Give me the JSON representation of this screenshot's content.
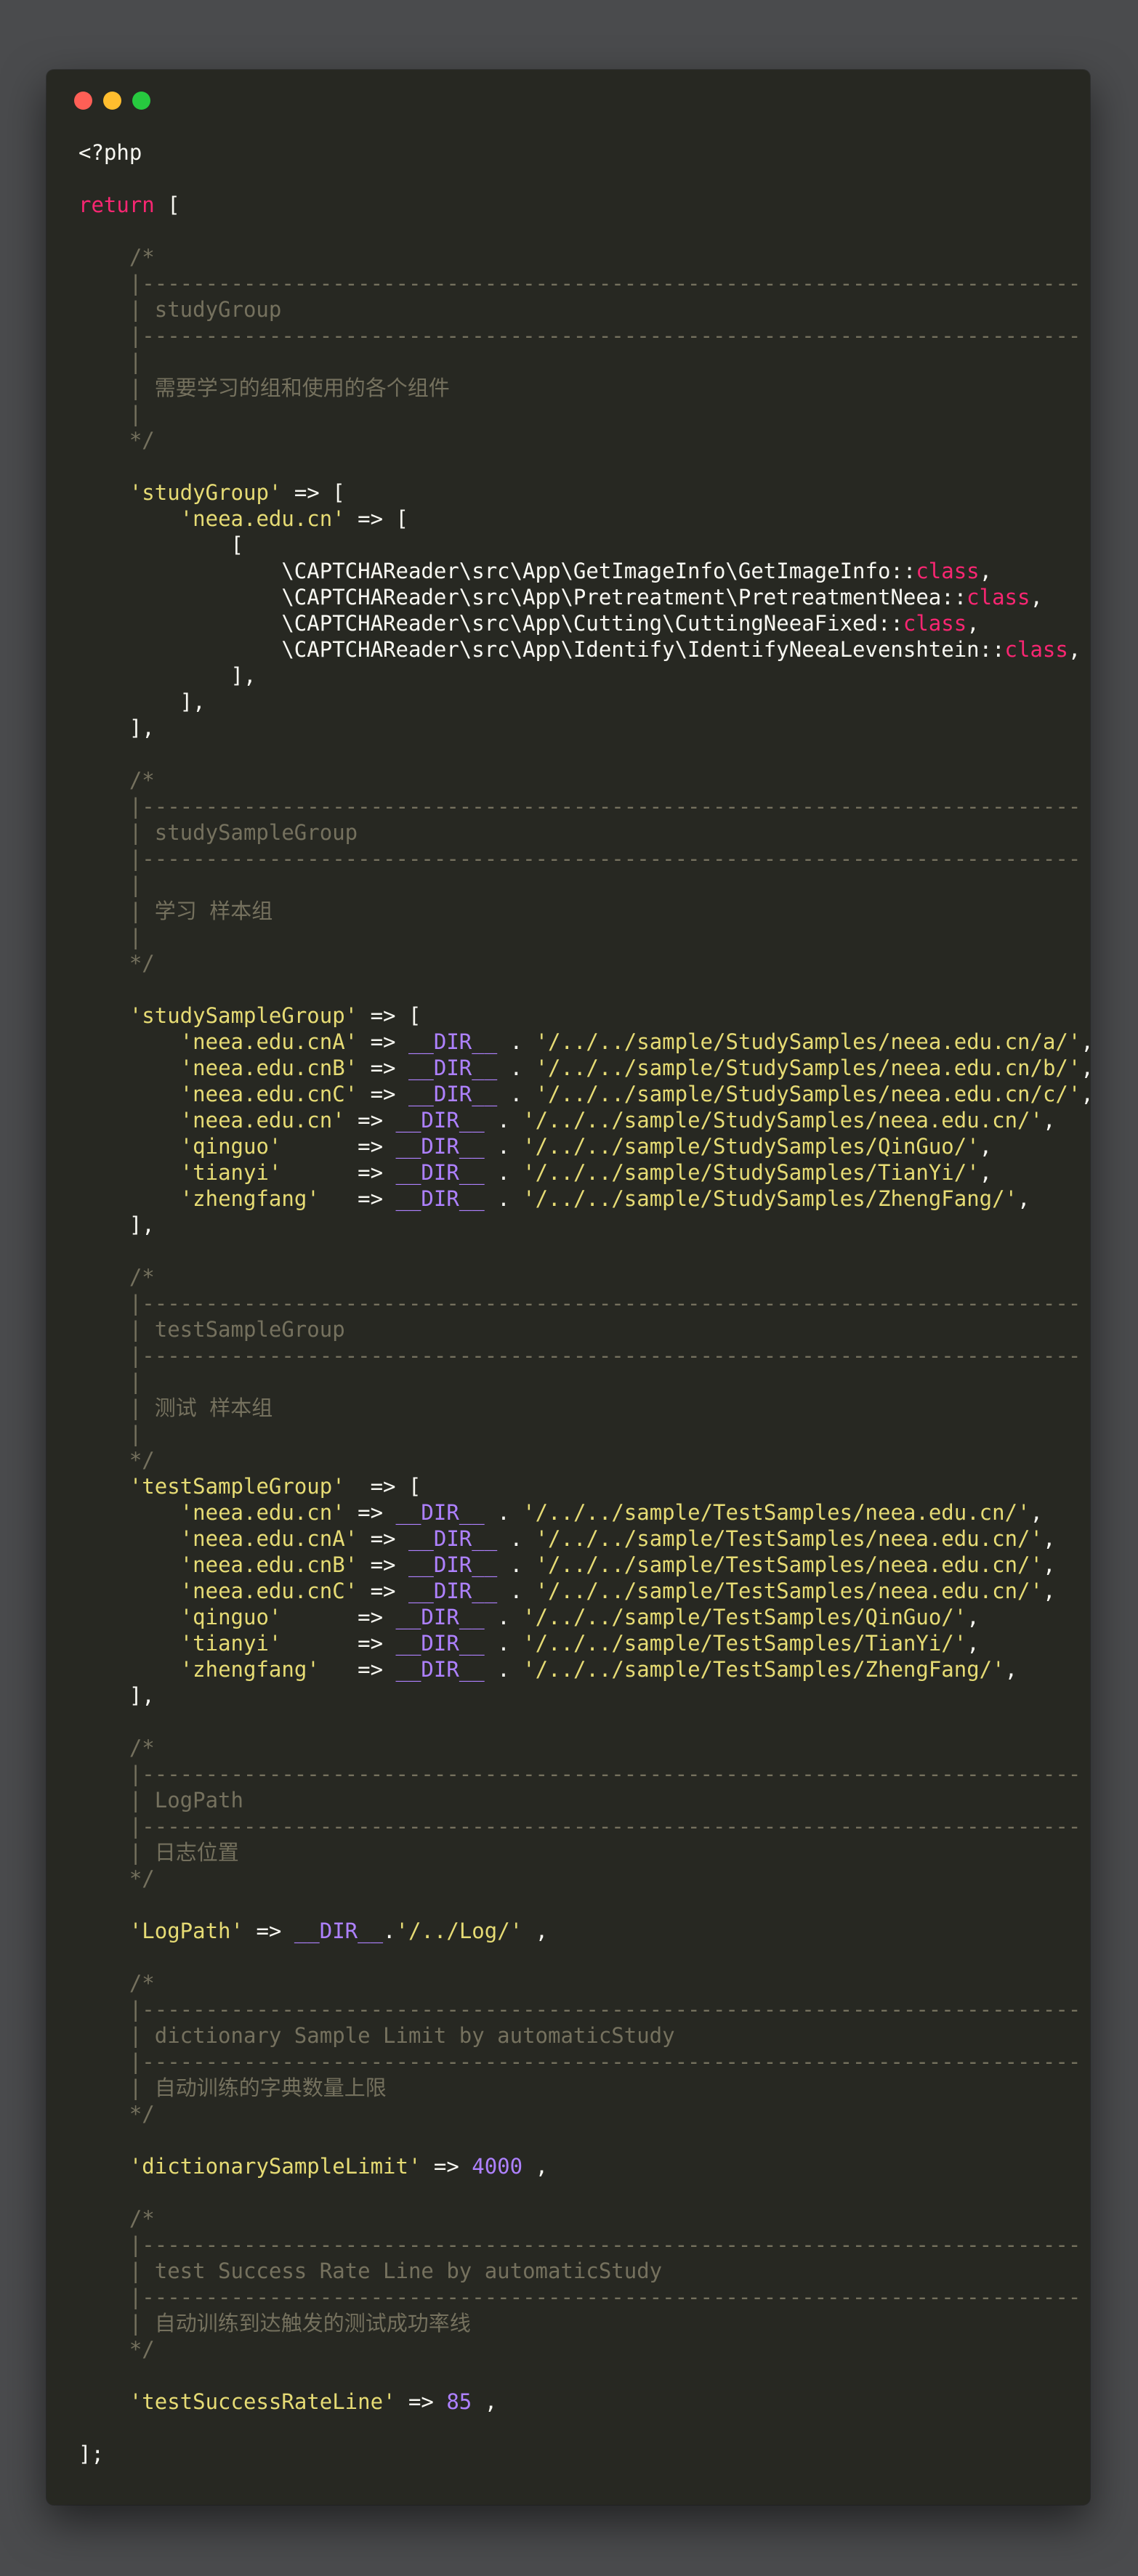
{
  "window": {
    "controls": [
      "close",
      "minimize",
      "maximize"
    ],
    "colors": {
      "background": "#272822",
      "comment": "#75715e",
      "string": "#e6db74",
      "keyword": "#f92672",
      "constant": "#ae81ff",
      "plain": "#f8f8f2"
    }
  },
  "code": {
    "lines": [
      [
        {
          "t": "p",
          "v": "<?php"
        }
      ],
      [],
      [
        {
          "t": "k",
          "v": "return"
        },
        {
          "t": "p",
          "v": " ["
        }
      ],
      [],
      [
        {
          "t": "c",
          "v": "    /*"
        }
      ],
      [
        {
          "t": "c",
          "v": "    |--------------------------------------------------------------------------"
        }
      ],
      [
        {
          "t": "c",
          "v": "    | studyGroup"
        }
      ],
      [
        {
          "t": "c",
          "v": "    |--------------------------------------------------------------------------"
        }
      ],
      [
        {
          "t": "c",
          "v": "    |"
        }
      ],
      [
        {
          "t": "c",
          "v": "    | 需要学习的组和使用的各个组件"
        }
      ],
      [
        {
          "t": "c",
          "v": "    |"
        }
      ],
      [
        {
          "t": "c",
          "v": "    */"
        }
      ],
      [],
      [
        {
          "t": "p",
          "v": "    "
        },
        {
          "t": "s",
          "v": "'studyGroup'"
        },
        {
          "t": "p",
          "v": " => ["
        }
      ],
      [
        {
          "t": "p",
          "v": "        "
        },
        {
          "t": "s",
          "v": "'neea.edu.cn'"
        },
        {
          "t": "p",
          "v": " => ["
        }
      ],
      [
        {
          "t": "p",
          "v": "            ["
        }
      ],
      [
        {
          "t": "p",
          "v": "                \\CAPTCHAReader\\src\\App\\GetImageInfo\\GetImageInfo::"
        },
        {
          "t": "k",
          "v": "class"
        },
        {
          "t": "p",
          "v": ","
        }
      ],
      [
        {
          "t": "p",
          "v": "                \\CAPTCHAReader\\src\\App\\Pretreatment\\PretreatmentNeea::"
        },
        {
          "t": "k",
          "v": "class"
        },
        {
          "t": "p",
          "v": ","
        }
      ],
      [
        {
          "t": "p",
          "v": "                \\CAPTCHAReader\\src\\App\\Cutting\\CuttingNeeaFixed::"
        },
        {
          "t": "k",
          "v": "class"
        },
        {
          "t": "p",
          "v": ","
        }
      ],
      [
        {
          "t": "p",
          "v": "                \\CAPTCHAReader\\src\\App\\Identify\\IdentifyNeeaLevenshtein::"
        },
        {
          "t": "k",
          "v": "class"
        },
        {
          "t": "p",
          "v": ","
        }
      ],
      [
        {
          "t": "p",
          "v": "            ],"
        }
      ],
      [
        {
          "t": "p",
          "v": "        ],"
        }
      ],
      [
        {
          "t": "p",
          "v": "    ],"
        }
      ],
      [],
      [
        {
          "t": "c",
          "v": "    /*"
        }
      ],
      [
        {
          "t": "c",
          "v": "    |--------------------------------------------------------------------------"
        }
      ],
      [
        {
          "t": "c",
          "v": "    | studySampleGroup"
        }
      ],
      [
        {
          "t": "c",
          "v": "    |--------------------------------------------------------------------------"
        }
      ],
      [
        {
          "t": "c",
          "v": "    |"
        }
      ],
      [
        {
          "t": "c",
          "v": "    | 学习 样本组"
        }
      ],
      [
        {
          "t": "c",
          "v": "    |"
        }
      ],
      [
        {
          "t": "c",
          "v": "    */"
        }
      ],
      [],
      [
        {
          "t": "p",
          "v": "    "
        },
        {
          "t": "s",
          "v": "'studySampleGroup'"
        },
        {
          "t": "p",
          "v": " => ["
        }
      ],
      [
        {
          "t": "p",
          "v": "        "
        },
        {
          "t": "s",
          "v": "'neea.edu.cnA'"
        },
        {
          "t": "p",
          "v": " => "
        },
        {
          "t": "m",
          "v": "__DIR__"
        },
        {
          "t": "p",
          "v": " . "
        },
        {
          "t": "s",
          "v": "'/../../sample/StudySamples/neea.edu.cn/a/'"
        },
        {
          "t": "p",
          "v": ","
        }
      ],
      [
        {
          "t": "p",
          "v": "        "
        },
        {
          "t": "s",
          "v": "'neea.edu.cnB'"
        },
        {
          "t": "p",
          "v": " => "
        },
        {
          "t": "m",
          "v": "__DIR__"
        },
        {
          "t": "p",
          "v": " . "
        },
        {
          "t": "s",
          "v": "'/../../sample/StudySamples/neea.edu.cn/b/'"
        },
        {
          "t": "p",
          "v": ","
        }
      ],
      [
        {
          "t": "p",
          "v": "        "
        },
        {
          "t": "s",
          "v": "'neea.edu.cnC'"
        },
        {
          "t": "p",
          "v": " => "
        },
        {
          "t": "m",
          "v": "__DIR__"
        },
        {
          "t": "p",
          "v": " . "
        },
        {
          "t": "s",
          "v": "'/../../sample/StudySamples/neea.edu.cn/c/'"
        },
        {
          "t": "p",
          "v": ","
        }
      ],
      [
        {
          "t": "p",
          "v": "        "
        },
        {
          "t": "s",
          "v": "'neea.edu.cn'"
        },
        {
          "t": "p",
          "v": " => "
        },
        {
          "t": "m",
          "v": "__DIR__"
        },
        {
          "t": "p",
          "v": " . "
        },
        {
          "t": "s",
          "v": "'/../../sample/StudySamples/neea.edu.cn/'"
        },
        {
          "t": "p",
          "v": ","
        }
      ],
      [
        {
          "t": "p",
          "v": "        "
        },
        {
          "t": "s",
          "v": "'qinguo'"
        },
        {
          "t": "p",
          "v": "      => "
        },
        {
          "t": "m",
          "v": "__DIR__"
        },
        {
          "t": "p",
          "v": " . "
        },
        {
          "t": "s",
          "v": "'/../../sample/StudySamples/QinGuo/'"
        },
        {
          "t": "p",
          "v": ","
        }
      ],
      [
        {
          "t": "p",
          "v": "        "
        },
        {
          "t": "s",
          "v": "'tianyi'"
        },
        {
          "t": "p",
          "v": "      => "
        },
        {
          "t": "m",
          "v": "__DIR__"
        },
        {
          "t": "p",
          "v": " . "
        },
        {
          "t": "s",
          "v": "'/../../sample/StudySamples/TianYi/'"
        },
        {
          "t": "p",
          "v": ","
        }
      ],
      [
        {
          "t": "p",
          "v": "        "
        },
        {
          "t": "s",
          "v": "'zhengfang'"
        },
        {
          "t": "p",
          "v": "   => "
        },
        {
          "t": "m",
          "v": "__DIR__"
        },
        {
          "t": "p",
          "v": " . "
        },
        {
          "t": "s",
          "v": "'/../../sample/StudySamples/ZhengFang/'"
        },
        {
          "t": "p",
          "v": ","
        }
      ],
      [
        {
          "t": "p",
          "v": "    ],"
        }
      ],
      [],
      [
        {
          "t": "c",
          "v": "    /*"
        }
      ],
      [
        {
          "t": "c",
          "v": "    |--------------------------------------------------------------------------"
        }
      ],
      [
        {
          "t": "c",
          "v": "    | testSampleGroup"
        }
      ],
      [
        {
          "t": "c",
          "v": "    |--------------------------------------------------------------------------"
        }
      ],
      [
        {
          "t": "c",
          "v": "    |"
        }
      ],
      [
        {
          "t": "c",
          "v": "    | 测试 样本组"
        }
      ],
      [
        {
          "t": "c",
          "v": "    |"
        }
      ],
      [
        {
          "t": "c",
          "v": "    */"
        }
      ],
      [
        {
          "t": "p",
          "v": "    "
        },
        {
          "t": "s",
          "v": "'testSampleGroup'"
        },
        {
          "t": "p",
          "v": "  => ["
        }
      ],
      [
        {
          "t": "p",
          "v": "        "
        },
        {
          "t": "s",
          "v": "'neea.edu.cn'"
        },
        {
          "t": "p",
          "v": " => "
        },
        {
          "t": "m",
          "v": "__DIR__"
        },
        {
          "t": "p",
          "v": " . "
        },
        {
          "t": "s",
          "v": "'/../../sample/TestSamples/neea.edu.cn/'"
        },
        {
          "t": "p",
          "v": ","
        }
      ],
      [
        {
          "t": "p",
          "v": "        "
        },
        {
          "t": "s",
          "v": "'neea.edu.cnA'"
        },
        {
          "t": "p",
          "v": " => "
        },
        {
          "t": "m",
          "v": "__DIR__"
        },
        {
          "t": "p",
          "v": " . "
        },
        {
          "t": "s",
          "v": "'/../../sample/TestSamples/neea.edu.cn/'"
        },
        {
          "t": "p",
          "v": ","
        }
      ],
      [
        {
          "t": "p",
          "v": "        "
        },
        {
          "t": "s",
          "v": "'neea.edu.cnB'"
        },
        {
          "t": "p",
          "v": " => "
        },
        {
          "t": "m",
          "v": "__DIR__"
        },
        {
          "t": "p",
          "v": " . "
        },
        {
          "t": "s",
          "v": "'/../../sample/TestSamples/neea.edu.cn/'"
        },
        {
          "t": "p",
          "v": ","
        }
      ],
      [
        {
          "t": "p",
          "v": "        "
        },
        {
          "t": "s",
          "v": "'neea.edu.cnC'"
        },
        {
          "t": "p",
          "v": " => "
        },
        {
          "t": "m",
          "v": "__DIR__"
        },
        {
          "t": "p",
          "v": " . "
        },
        {
          "t": "s",
          "v": "'/../../sample/TestSamples/neea.edu.cn/'"
        },
        {
          "t": "p",
          "v": ","
        }
      ],
      [
        {
          "t": "p",
          "v": "        "
        },
        {
          "t": "s",
          "v": "'qinguo'"
        },
        {
          "t": "p",
          "v": "      => "
        },
        {
          "t": "m",
          "v": "__DIR__"
        },
        {
          "t": "p",
          "v": " . "
        },
        {
          "t": "s",
          "v": "'/../../sample/TestSamples/QinGuo/'"
        },
        {
          "t": "p",
          "v": ","
        }
      ],
      [
        {
          "t": "p",
          "v": "        "
        },
        {
          "t": "s",
          "v": "'tianyi'"
        },
        {
          "t": "p",
          "v": "      => "
        },
        {
          "t": "m",
          "v": "__DIR__"
        },
        {
          "t": "p",
          "v": " . "
        },
        {
          "t": "s",
          "v": "'/../../sample/TestSamples/TianYi/'"
        },
        {
          "t": "p",
          "v": ","
        }
      ],
      [
        {
          "t": "p",
          "v": "        "
        },
        {
          "t": "s",
          "v": "'zhengfang'"
        },
        {
          "t": "p",
          "v": "   => "
        },
        {
          "t": "m",
          "v": "__DIR__"
        },
        {
          "t": "p",
          "v": " . "
        },
        {
          "t": "s",
          "v": "'/../../sample/TestSamples/ZhengFang/'"
        },
        {
          "t": "p",
          "v": ","
        }
      ],
      [
        {
          "t": "p",
          "v": "    ],"
        }
      ],
      [],
      [
        {
          "t": "c",
          "v": "    /*"
        }
      ],
      [
        {
          "t": "c",
          "v": "    |--------------------------------------------------------------------------"
        }
      ],
      [
        {
          "t": "c",
          "v": "    | LogPath"
        }
      ],
      [
        {
          "t": "c",
          "v": "    |--------------------------------------------------------------------------"
        }
      ],
      [
        {
          "t": "c",
          "v": "    | 日志位置"
        }
      ],
      [
        {
          "t": "c",
          "v": "    */"
        }
      ],
      [],
      [
        {
          "t": "p",
          "v": "    "
        },
        {
          "t": "s",
          "v": "'LogPath'"
        },
        {
          "t": "p",
          "v": " => "
        },
        {
          "t": "m",
          "v": "__DIR__"
        },
        {
          "t": "p",
          "v": "."
        },
        {
          "t": "s",
          "v": "'/../Log/'"
        },
        {
          "t": "p",
          "v": " ,"
        }
      ],
      [],
      [
        {
          "t": "c",
          "v": "    /*"
        }
      ],
      [
        {
          "t": "c",
          "v": "    |--------------------------------------------------------------------------"
        }
      ],
      [
        {
          "t": "c",
          "v": "    | dictionary Sample Limit by automaticStudy"
        }
      ],
      [
        {
          "t": "c",
          "v": "    |--------------------------------------------------------------------------"
        }
      ],
      [
        {
          "t": "c",
          "v": "    | 自动训练的字典数量上限"
        }
      ],
      [
        {
          "t": "c",
          "v": "    */"
        }
      ],
      [],
      [
        {
          "t": "p",
          "v": "    "
        },
        {
          "t": "s",
          "v": "'dictionarySampleLimit'"
        },
        {
          "t": "p",
          "v": " => "
        },
        {
          "t": "m",
          "v": "4000"
        },
        {
          "t": "p",
          "v": " ,"
        }
      ],
      [],
      [
        {
          "t": "c",
          "v": "    /*"
        }
      ],
      [
        {
          "t": "c",
          "v": "    |--------------------------------------------------------------------------"
        }
      ],
      [
        {
          "t": "c",
          "v": "    | test Success Rate Line by automaticStudy"
        }
      ],
      [
        {
          "t": "c",
          "v": "    |--------------------------------------------------------------------------"
        }
      ],
      [
        {
          "t": "c",
          "v": "    | 自动训练到达触发的测试成功率线"
        }
      ],
      [
        {
          "t": "c",
          "v": "    */"
        }
      ],
      [],
      [
        {
          "t": "p",
          "v": "    "
        },
        {
          "t": "s",
          "v": "'testSuccessRateLine'"
        },
        {
          "t": "p",
          "v": " => "
        },
        {
          "t": "m",
          "v": "85"
        },
        {
          "t": "p",
          "v": " ,"
        }
      ],
      [],
      [
        {
          "t": "p",
          "v": "];"
        }
      ]
    ]
  }
}
